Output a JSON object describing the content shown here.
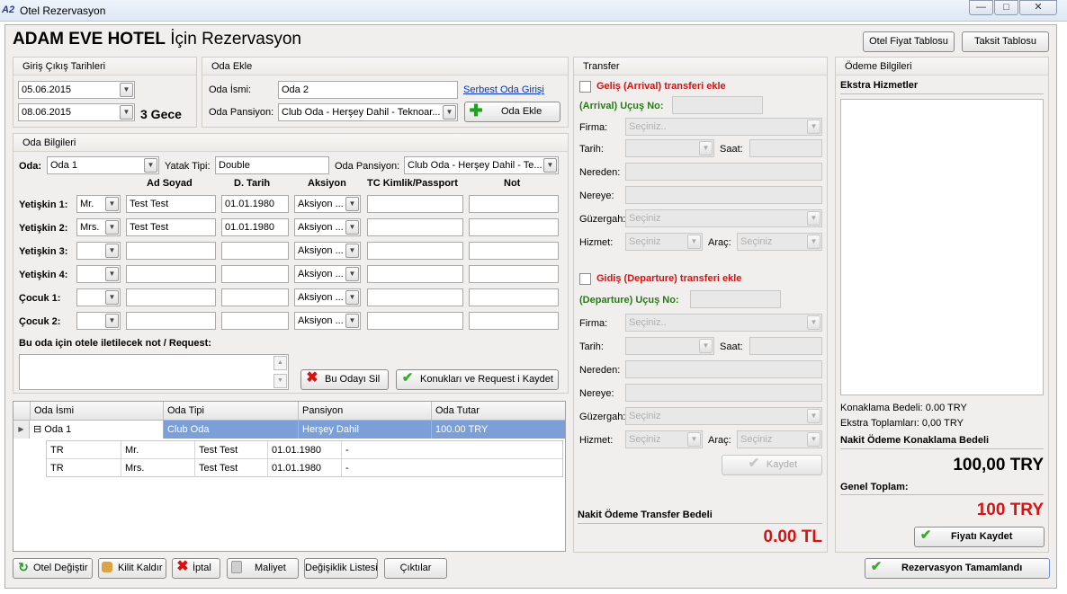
{
  "window": {
    "logo": "A2",
    "title": "Otel Rezervasyon"
  },
  "header": {
    "title_bold": "ADAM  EVE HOTEL",
    "title_rest": " İçin Rezervasyon",
    "btn_price_table": "Otel Fiyat Tablosu",
    "btn_installment_table": "Taksit Tablosu"
  },
  "dates": {
    "group_title": "Giriş Çıkış Tarihleri",
    "checkin": "05.06.2015",
    "checkout": "08.06.2015",
    "nights": "3 Gece"
  },
  "add_room": {
    "group_title": "Oda Ekle",
    "room_name_label": "Oda İsmi:",
    "room_name_value": "Oda 2",
    "free_entry_link": "Serbest Oda Girişi",
    "board_label": "Oda Pansiyon:",
    "board_value": "Club Oda - Herşey Dahil - Teknoar...",
    "add_button": "Oda Ekle"
  },
  "room_info": {
    "group_title": "Oda Bilgileri",
    "room_label": "Oda:",
    "room_value": "Oda 1",
    "bed_label": "Yatak Tipi:",
    "bed_value": "Double",
    "board_label": "Oda Pansiyon:",
    "board_value": "Club Oda - Herşey Dahil - Te...",
    "columns": [
      "Ad Soyad",
      "D. Tarih",
      "Aksiyon",
      "TC Kimlik/Passport",
      "Not"
    ],
    "guests": [
      {
        "label": "Yetişkin 1:",
        "title": "Mr.",
        "name": "Test Test",
        "dob": "01.01.1980",
        "action": "Aksiyon ...",
        "id": "",
        "note": ""
      },
      {
        "label": "Yetişkin 2:",
        "title": "Mrs.",
        "name": "Test Test",
        "dob": "01.01.1980",
        "action": "Aksiyon ...",
        "id": "",
        "note": ""
      },
      {
        "label": "Yetişkin 3:",
        "title": "",
        "name": "",
        "dob": "",
        "action": "Aksiyon ...",
        "id": "",
        "note": ""
      },
      {
        "label": "Yetişkin 4:",
        "title": "",
        "name": "",
        "dob": "",
        "action": "Aksiyon ...",
        "id": "",
        "note": ""
      },
      {
        "label": "Çocuk 1:",
        "title": "",
        "name": "",
        "dob": "",
        "action": "Aksiyon ...",
        "id": "",
        "note": ""
      },
      {
        "label": "Çocuk 2:",
        "title": "",
        "name": "",
        "dob": "",
        "action": "Aksiyon ...",
        "id": "",
        "note": ""
      }
    ],
    "note_label": "Bu oda için otele iletilecek not / Request:",
    "note_value": "",
    "delete_button": "Bu Odayı Sil",
    "save_button": "Konukları ve Request i Kaydet"
  },
  "rooms_grid": {
    "columns": [
      "Oda İsmi",
      "Oda Tipi",
      "Pansiyon",
      "Oda Tutar"
    ],
    "row": {
      "expander": "⊟",
      "name": "Oda 1",
      "type": "Club Oda",
      "board": "Herşey Dahil",
      "amount": "100.00 TRY"
    },
    "guests": [
      {
        "nat": "TR",
        "title": "Mr.",
        "name": "Test Test",
        "dob": "01.01.1980",
        "dash": "-"
      },
      {
        "nat": "TR",
        "title": "Mrs.",
        "name": "Test Test",
        "dob": "01.01.1980",
        "dash": "-"
      }
    ]
  },
  "transfer": {
    "group_title": "Transfer",
    "arrival_check": "Geliş (Arrival) transferi ekle",
    "arrival_flight_label": "(Arrival) Uçuş No:",
    "departure_check": "Gidiş (Departure) transferi ekle",
    "departure_flight_label": "(Departure) Uçuş No:",
    "firm_label": "Firma:",
    "firm_placeholder": "Seçiniz..",
    "date_label": "Tarih:",
    "time_label": "Saat:",
    "from_label": "Nereden:",
    "to_label": "Nereye:",
    "route_label": "Güzergah:",
    "route_placeholder": "Seçiniz",
    "service_label": "Hizmet:",
    "service_placeholder": "Seçiniz",
    "vehicle_label": "Araç:",
    "vehicle_placeholder": "Seçiniz",
    "save_button": "Kaydet",
    "cash_label": "Nakit Ödeme Transfer Bedeli",
    "cash_value": "0.00 TL"
  },
  "payment": {
    "group_title": "Ödeme Bilgileri",
    "extras_title": "Ekstra Hizmetler",
    "accommodation_line": "Konaklama Bedeli:  0.00 TRY",
    "extras_line": "Ekstra Toplamları:  0,00 TRY",
    "cash_accommodation_label": "Nakit Ödeme Konaklama Bedeli",
    "cash_accommodation_value": "100,00 TRY",
    "grand_total_label": "Genel Toplam:",
    "grand_total_value": "100 TRY",
    "save_price_button": "Fiyatı Kaydet"
  },
  "footer": {
    "change_hotel": "Otel Değiştir",
    "unlock": "Kilit Kaldır",
    "cancel": "İptal",
    "cost": "Maliyet",
    "change_list": "Değişiklik Listesi",
    "outputs": "Çıktılar",
    "complete": "Rezervasyon Tamamlandı"
  },
  "colors": {
    "accent_red": "#d61212",
    "accent_green": "#2a7a16",
    "selected_row": "#7d9fd8"
  }
}
